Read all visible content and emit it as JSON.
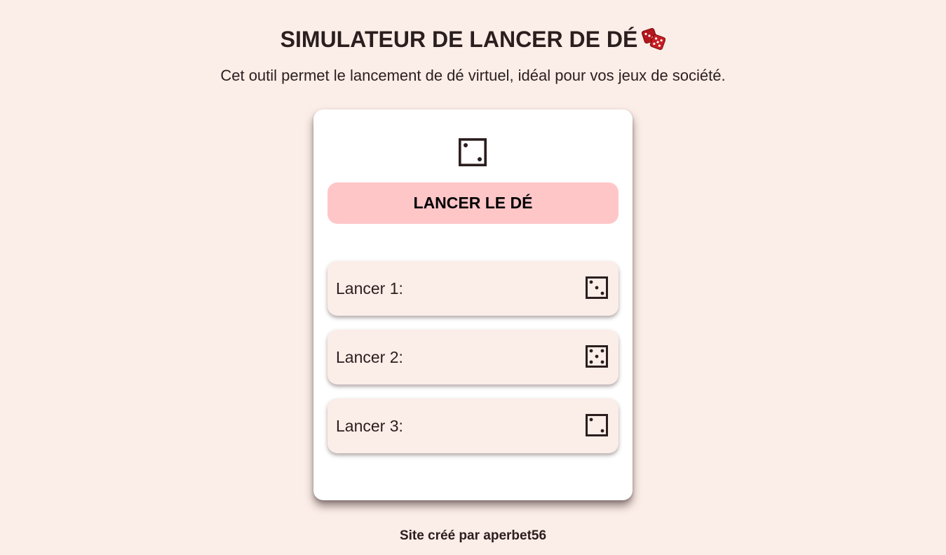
{
  "header": {
    "title": "SIMULATEUR DE LANCER DE DÉ",
    "title_icon": "game-die-emoji",
    "subtitle": "Cet outil permet le lancement de dé virtuel, idéal pour vos jeux de société."
  },
  "main": {
    "current_die_value": 2,
    "roll_button_label": "LANCER LE DÉ",
    "history": [
      {
        "label": "Lancer 1:",
        "value": 3
      },
      {
        "label": "Lancer 2:",
        "value": 5
      },
      {
        "label": "Lancer 3:",
        "value": 2
      }
    ]
  },
  "footer": {
    "text": "Site créé par aperbet56"
  },
  "colors": {
    "background": "#fbede7",
    "card": "#ffffff",
    "button": "#ffc6c8",
    "history_item": "#fbede7",
    "text": "#2b1e1e",
    "emoji_red": "#b3161b"
  }
}
